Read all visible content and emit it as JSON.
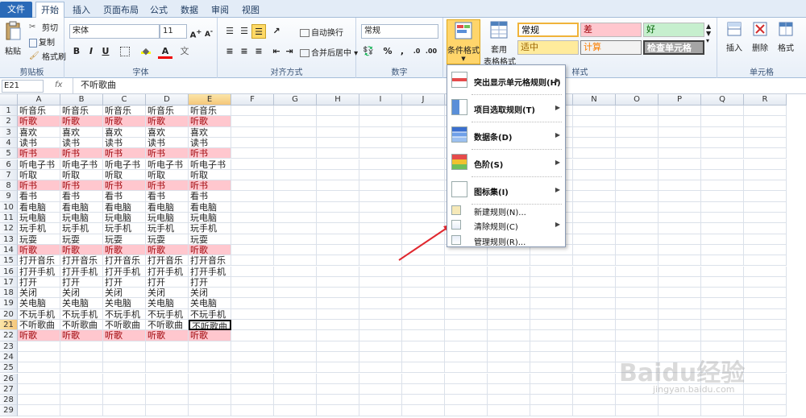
{
  "tabs": [
    "文件",
    "开始",
    "插入",
    "页面布局",
    "公式",
    "数据",
    "审阅",
    "视图"
  ],
  "clipboard": {
    "paste": "粘贴",
    "cut": "剪切",
    "copy": "复制",
    "format_painter": "格式刷",
    "label": "剪贴板"
  },
  "font": {
    "name": "宋体",
    "size": "11",
    "label": "字体"
  },
  "alignment": {
    "wrap": "自动换行",
    "merge": "合并后居中",
    "label": "对齐方式"
  },
  "number": {
    "format": "常规",
    "label": "数字"
  },
  "styles": {
    "cond_format": "条件格式",
    "table_format_1": "套用",
    "table_format_2": "表格格式",
    "label": "样式",
    "cells": [
      {
        "text": "常规",
        "bg": "#ffffff",
        "fg": "#000000"
      },
      {
        "text": "差",
        "bg": "#ffc7ce",
        "fg": "#9c0006"
      },
      {
        "text": "好",
        "bg": "#c6efce",
        "fg": "#006100"
      },
      {
        "text": "适中",
        "bg": "#ffeb9c",
        "fg": "#9c6500"
      },
      {
        "text": "计算",
        "bg": "#f2f2f2",
        "fg": "#fa7d00"
      },
      {
        "text": "检查单元格",
        "bg": "#a5a5a5",
        "fg": "#ffffff"
      }
    ]
  },
  "cells_group": {
    "insert": "插入",
    "delete": "删除",
    "format": "格式",
    "label": "单元格"
  },
  "formula_bar": {
    "name_box": "E21",
    "fx": "fx",
    "value": "不听歌曲"
  },
  "columns": [
    "A",
    "B",
    "C",
    "D",
    "E",
    "F",
    "G",
    "H",
    "I",
    "J",
    "K",
    "L",
    "M",
    "N",
    "O",
    "P",
    "Q",
    "R"
  ],
  "rows": [
    {
      "n": "1",
      "text": "听音乐",
      "pink": false
    },
    {
      "n": "2",
      "text": "听歌",
      "pink": true
    },
    {
      "n": "3",
      "text": "喜欢",
      "pink": false
    },
    {
      "n": "4",
      "text": "读书",
      "pink": false
    },
    {
      "n": "5",
      "text": "听书",
      "pink": true
    },
    {
      "n": "6",
      "text": "听电子书",
      "pink": false
    },
    {
      "n": "7",
      "text": "听取",
      "pink": false
    },
    {
      "n": "8",
      "text": "听书",
      "pink": true
    },
    {
      "n": "9",
      "text": "看书",
      "pink": false
    },
    {
      "n": "10",
      "text": "看电脑",
      "pink": false
    },
    {
      "n": "11",
      "text": "玩电脑",
      "pink": false
    },
    {
      "n": "12",
      "text": "玩手机",
      "pink": false
    },
    {
      "n": "13",
      "text": "玩耍",
      "pink": false
    },
    {
      "n": "14",
      "text": "听歌",
      "pink": true
    },
    {
      "n": "15",
      "text": "打开音乐",
      "pink": false
    },
    {
      "n": "16",
      "text": "打开手机",
      "pink": false
    },
    {
      "n": "17",
      "text": "打开",
      "pink": false
    },
    {
      "n": "18",
      "text": "关闭",
      "pink": false
    },
    {
      "n": "19",
      "text": "关电脑",
      "pink": false
    },
    {
      "n": "20",
      "text": "不玩手机",
      "pink": false
    },
    {
      "n": "21",
      "text": "不听歌曲",
      "pink": false
    },
    {
      "n": "22",
      "text": "听歌",
      "pink": true
    },
    {
      "n": "23",
      "text": "",
      "pink": false
    },
    {
      "n": "24",
      "text": "",
      "pink": false
    },
    {
      "n": "25",
      "text": "",
      "pink": false
    },
    {
      "n": "26",
      "text": "",
      "pink": false
    },
    {
      "n": "27",
      "text": "",
      "pink": false
    },
    {
      "n": "28",
      "text": "",
      "pink": false
    },
    {
      "n": "29",
      "text": "",
      "pink": false
    }
  ],
  "menu": {
    "items": [
      {
        "label": "突出显示单元格规则(H)",
        "icon": "highlight-rules-icon",
        "arrow": true
      },
      {
        "label": "项目选取规则(T)",
        "icon": "top-bottom-rules-icon",
        "arrow": true
      },
      {
        "label": "数据条(D)",
        "icon": "data-bars-icon",
        "arrow": true
      },
      {
        "label": "色阶(S)",
        "icon": "color-scales-icon",
        "arrow": true
      },
      {
        "label": "图标集(I)",
        "icon": "icon-sets-icon",
        "arrow": true
      },
      {
        "label": "新建规则(N)...",
        "icon": "new-rule-icon",
        "arrow": false
      },
      {
        "label": "清除规则(C)",
        "icon": "clear-rules-icon",
        "arrow": true
      },
      {
        "label": "管理规则(R)...",
        "icon": "manage-rules-icon",
        "arrow": false
      }
    ]
  },
  "selection": {
    "cell": "E21"
  },
  "colors": {
    "accent": "#2a6ab8",
    "pink_bg": "#ffc7ce",
    "pink_fg": "#9c0006",
    "annotation_arrow": "#e0282f"
  },
  "watermark": {
    "brand": "Baidu经验",
    "url": "jingyan.baidu.com"
  }
}
